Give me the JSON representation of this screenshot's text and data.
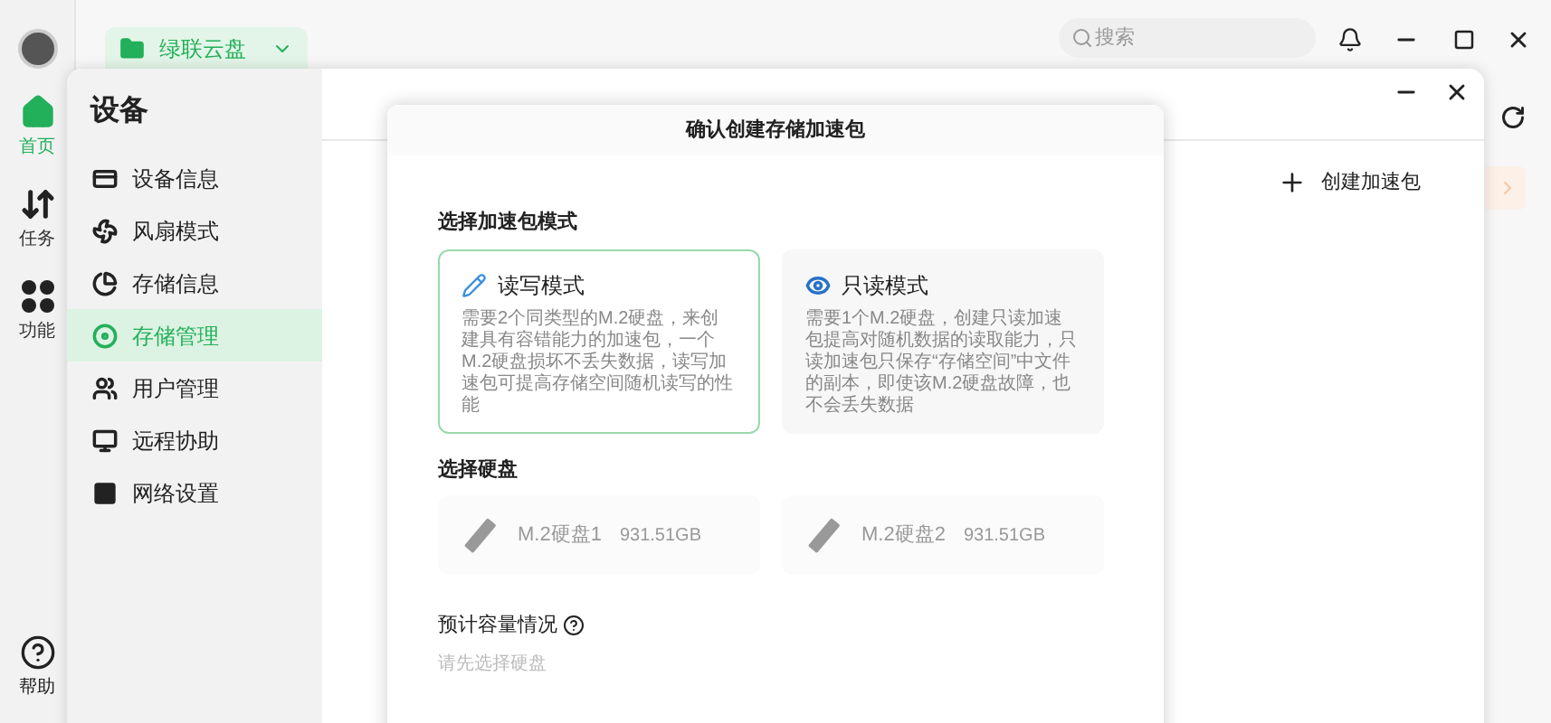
{
  "rail": {
    "items": [
      {
        "label": "首页",
        "selected": true
      },
      {
        "label": "任务",
        "selected": false
      },
      {
        "label": "功能",
        "selected": false
      }
    ],
    "help": {
      "label": "帮助"
    }
  },
  "top_bar": {
    "drive": "绿联云盘",
    "search": {
      "placeholder": "搜索"
    }
  },
  "settings": {
    "title": "设备",
    "items": [
      {
        "label": "设备信息",
        "selected": false
      },
      {
        "label": "风扇模式",
        "selected": false
      },
      {
        "label": "存储信息",
        "selected": false
      },
      {
        "label": "存储管理",
        "selected": true
      },
      {
        "label": "用户管理",
        "selected": false
      },
      {
        "label": "远程协助",
        "selected": false
      },
      {
        "label": "网络设置",
        "selected": false
      }
    ],
    "create_button": "创建加速包"
  },
  "dialog": {
    "title": "确认创建存储加速包",
    "mode_heading": "选择加速包模式",
    "modes": [
      {
        "title": "读写模式",
        "description": "需要2个同类型的M.2硬盘，来创建具有容错能力的加速包，一个M.2硬盘损坏不丢失数据，读写加速包可提高存储空间随机读写的性能",
        "selected": true
      },
      {
        "title": "只读模式",
        "description": "需要1个M.2硬盘，创建只读加速包提高对随机数据的读取能力，只读加速包只保存“存储空间”中文件的副本，即使该M.2硬盘故障，也不会丢失数据",
        "selected": false
      }
    ],
    "disk_heading": "选择硬盘",
    "disks": [
      {
        "name": "M.2硬盘1",
        "size": "931.51GB",
        "disabled": true
      },
      {
        "name": "M.2硬盘2",
        "size": "931.51GB",
        "disabled": true
      }
    ],
    "capacity_heading": "预计容量情况",
    "capacity_hint": "请先选择硬盘"
  }
}
